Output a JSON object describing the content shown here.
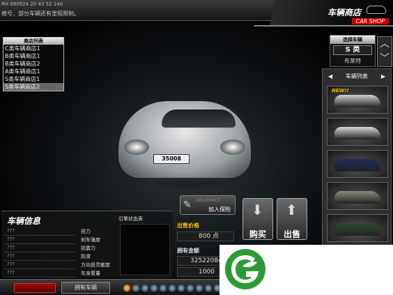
{
  "top": {
    "line1": "RH 090924 20 43 52 140",
    "line2": "络号，部分车辆还有里程限制。"
  },
  "shop": {
    "title_cn": "车辆商店",
    "title_en": "CAR SHOP"
  },
  "stores": {
    "header": "商店列表",
    "items": [
      "C类车辆商店1",
      "B类车辆商店1",
      "B类车辆商店2",
      "A类车辆商店1",
      "S类车辆商店1",
      "S类车辆商店2"
    ],
    "selected_index": 5
  },
  "select": {
    "header": "选择车辆",
    "class_value": "S 类",
    "brand_value": "布莱特"
  },
  "car_list": {
    "header": "车辆列表",
    "prev": "◀",
    "next": "▶",
    "new_badge": "NEW!!",
    "colors": [
      "#cfd3d6",
      "#d8d8d8",
      "#1d2c58",
      "#8c8a80",
      "#2f4a33"
    ]
  },
  "plate": "35008",
  "insurance": {
    "title": "INSURANCE",
    "label": "加入保险"
  },
  "buttons": {
    "buy": "购买",
    "sell": "出售"
  },
  "price": {
    "label": "出售价格",
    "value": "800 点",
    "money_label": "拥有金额",
    "money_value": "32522084",
    "money_value2": "1000"
  },
  "info": {
    "title": "车辆信息",
    "engine_title": "引擎状态表",
    "unknowns": [
      "???",
      "???",
      "???",
      "???",
      "???",
      "???"
    ],
    "stats": [
      "扭力",
      "刹车强度",
      "防震力",
      "防滑",
      "方向盘灵敏度",
      "车身重量"
    ]
  },
  "bottom": {
    "owned": "拥有车辆",
    "dot_count": 12,
    "active_dot": 0
  }
}
